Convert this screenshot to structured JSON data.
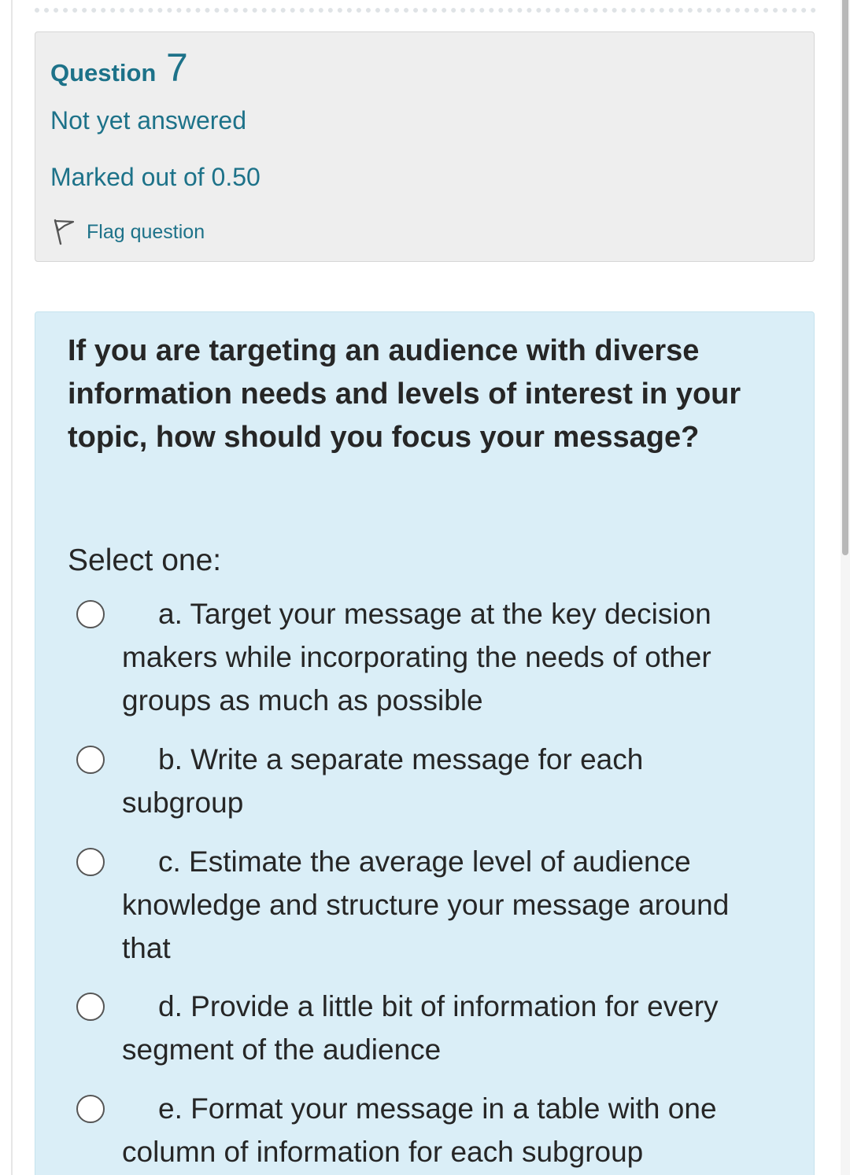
{
  "question": {
    "label": "Question",
    "number": "7",
    "state": "Not yet answered",
    "grade": "Marked out of 0.50",
    "flag_label": "Flag question",
    "flag_icon": "flag-icon"
  },
  "content": {
    "text": "If you are targeting an audience with diverse information needs and levels of interest in your topic, how should you focus your message?",
    "prompt": "Select one:",
    "options": [
      {
        "label": "a. Target your message at the key decision makers while incorporating the needs of other groups as much as possible",
        "selected": false
      },
      {
        "label": "b. Write a separate message for each subgroup",
        "selected": false
      },
      {
        "label": "c. Estimate the average level of audience knowledge and structure your message around that",
        "selected": false
      },
      {
        "label": "d. Provide a little bit of information for every segment of the audience",
        "selected": false
      },
      {
        "label": "e. Format your message in a table with one column of information for each subgroup",
        "selected": false
      }
    ]
  },
  "colors": {
    "accent": "#1d7289",
    "info_bg": "#eeeeee",
    "content_bg": "#daeef7",
    "text": "#262626"
  }
}
